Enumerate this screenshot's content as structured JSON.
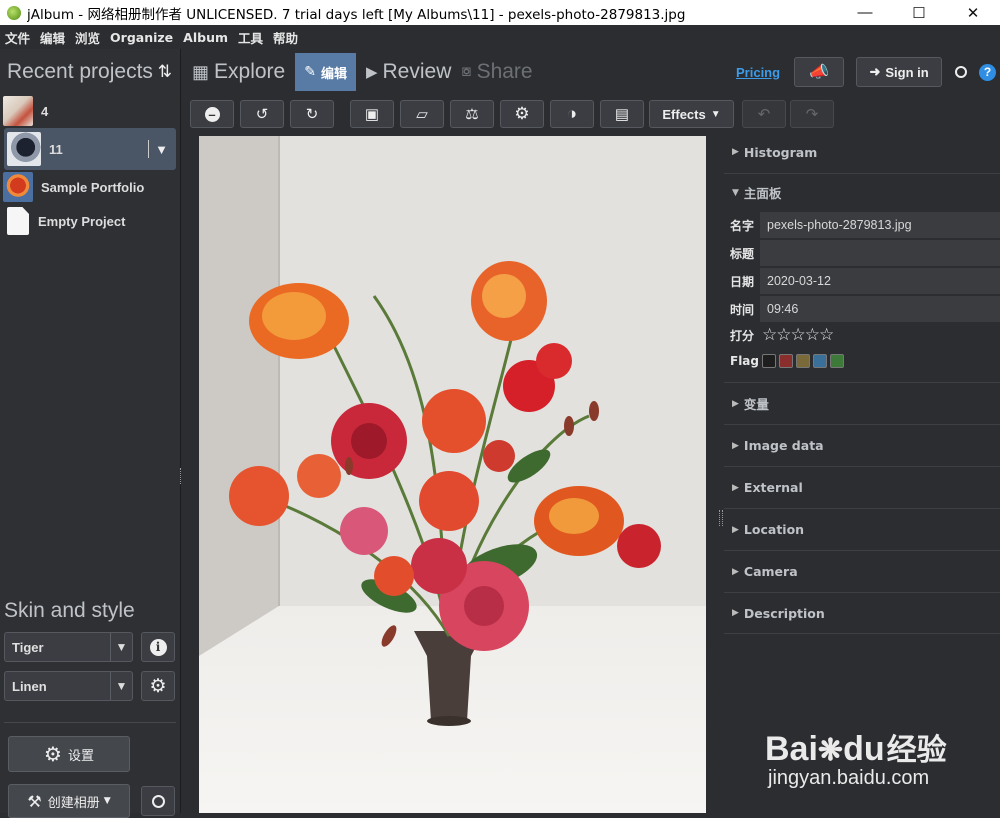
{
  "titlebar": {
    "title": "jAlbum - 网络相册制作者 UNLICENSED. 7 trial days left [My Albums\\11] - pexels-photo-2879813.jpg"
  },
  "menu": [
    "文件",
    "编辑",
    "浏览",
    "Organize",
    "Album",
    "工具",
    "帮助"
  ],
  "left": {
    "recent_title": "Recent projects",
    "projects": [
      {
        "name": "4",
        "icon": "bouquet-thumb"
      },
      {
        "name": "11",
        "icon": "portrait-thumb"
      },
      {
        "name": "Sample Portfolio",
        "icon": "flower-thumb"
      },
      {
        "name": "Empty Project",
        "icon": "blank-page-icon"
      }
    ],
    "skin_title": "Skin and style",
    "skin": "Tiger",
    "style": "Linen",
    "settings_label": "设置",
    "create_label": "创建相册"
  },
  "tabs": {
    "explore": "Explore",
    "edit": "编辑",
    "review": "Review",
    "share": "Share"
  },
  "topright": {
    "pricing": "Pricing",
    "signin": "Sign in"
  },
  "toolbar": {
    "effects": "Effects"
  },
  "inspector": {
    "histogram": "Histogram",
    "panel": "主面板",
    "fields": [
      {
        "key": "名字",
        "value": "pexels-photo-2879813.jpg"
      },
      {
        "key": "标题",
        "value": ""
      },
      {
        "key": "日期",
        "value": "2020-03-12"
      },
      {
        "key": "时间",
        "value": "09:46"
      }
    ],
    "rating_label": "打分",
    "rating_stars": "☆☆☆☆☆",
    "flag_label": "Flag",
    "flag_colors": [
      "#1e1e1e",
      "#8a2d2d",
      "#7a6a3a",
      "#3a6f9a",
      "#3d7a3a"
    ],
    "sections": [
      "变量",
      "Image data",
      "External",
      "Location",
      "Camera",
      "Description"
    ]
  },
  "watermark": {
    "brand": "Bai",
    "brand2": "du",
    "cn": "经验",
    "url": "jingyan.baidu.com"
  }
}
